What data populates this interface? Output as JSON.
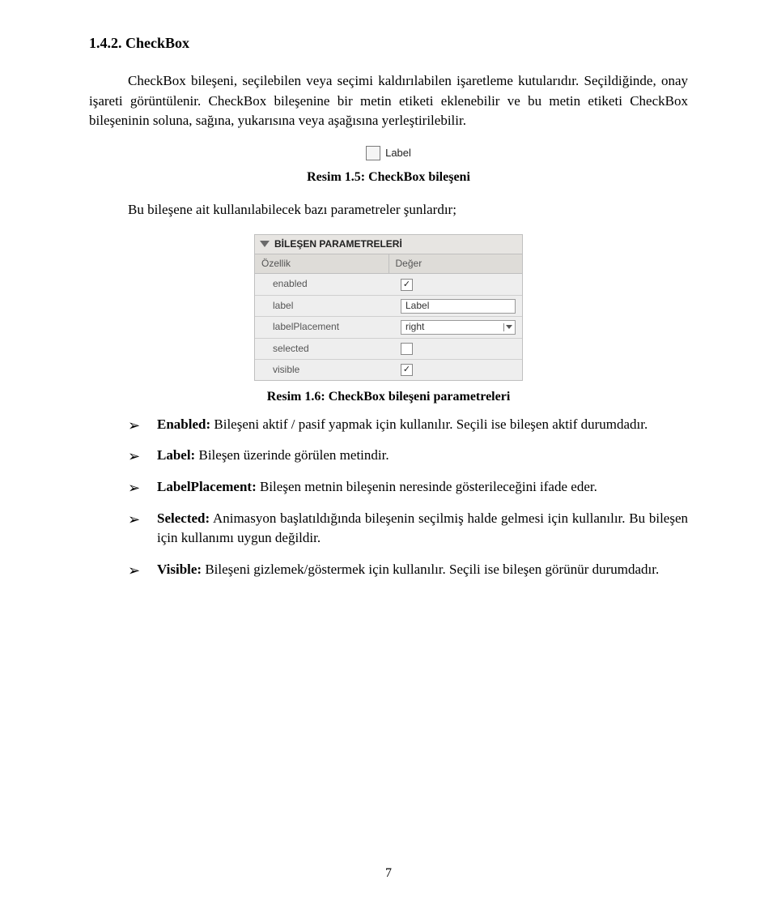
{
  "section_number": "1.4.2.",
  "section_title": "CheckBox",
  "para_intro": "CheckBox bileşeni, seçilebilen veya seçimi kaldırılabilen işaretleme kutularıdır. Seçildiğinde, onay işareti görüntülenir. CheckBox bileşenine bir metin etiketi eklenebilir ve bu metin etiketi CheckBox bileşeninin soluna, sağına, yukarısına veya aşağısına yerleştirilebilir.",
  "figure1": {
    "caption": "Resim 1.5: CheckBox bileşeni",
    "label_text": "Label"
  },
  "para_after_fig1": "Bu bileşene ait kullanılabilecek bazı parametreler şunlardır;",
  "panel": {
    "title": "BİLEŞEN PARAMETRELERİ",
    "col_property": "Özellik",
    "col_value": "Değer",
    "rows": [
      {
        "name": "enabled",
        "type": "check",
        "checked": true
      },
      {
        "name": "label",
        "type": "text",
        "value": "Label"
      },
      {
        "name": "labelPlacement",
        "type": "select",
        "value": "right"
      },
      {
        "name": "selected",
        "type": "check",
        "checked": false
      },
      {
        "name": "visible",
        "type": "check",
        "checked": true
      }
    ]
  },
  "figure2_caption": "Resim 1.6: CheckBox bileşeni parametreleri",
  "bullets": [
    {
      "b": "Enabled:",
      "t": " Bileşeni aktif / pasif yapmak için kullanılır. Seçili ise bileşen aktif durumdadır."
    },
    {
      "b": "Label:",
      "t": " Bileşen üzerinde görülen metindir."
    },
    {
      "b": "LabelPlacement:",
      "t": " Bileşen metnin bileşenin neresinde gösterileceğini ifade eder."
    },
    {
      "b": "Selected:",
      "t": " Animasyon başlatıldığında bileşenin seçilmiş halde gelmesi için kullanılır. Bu bileşen için kullanımı uygun değildir."
    },
    {
      "b": "Visible:",
      "t": " Bileşeni gizlemek/göstermek için kullanılır. Seçili ise bileşen görünür durumdadır."
    }
  ],
  "page_number": "7"
}
